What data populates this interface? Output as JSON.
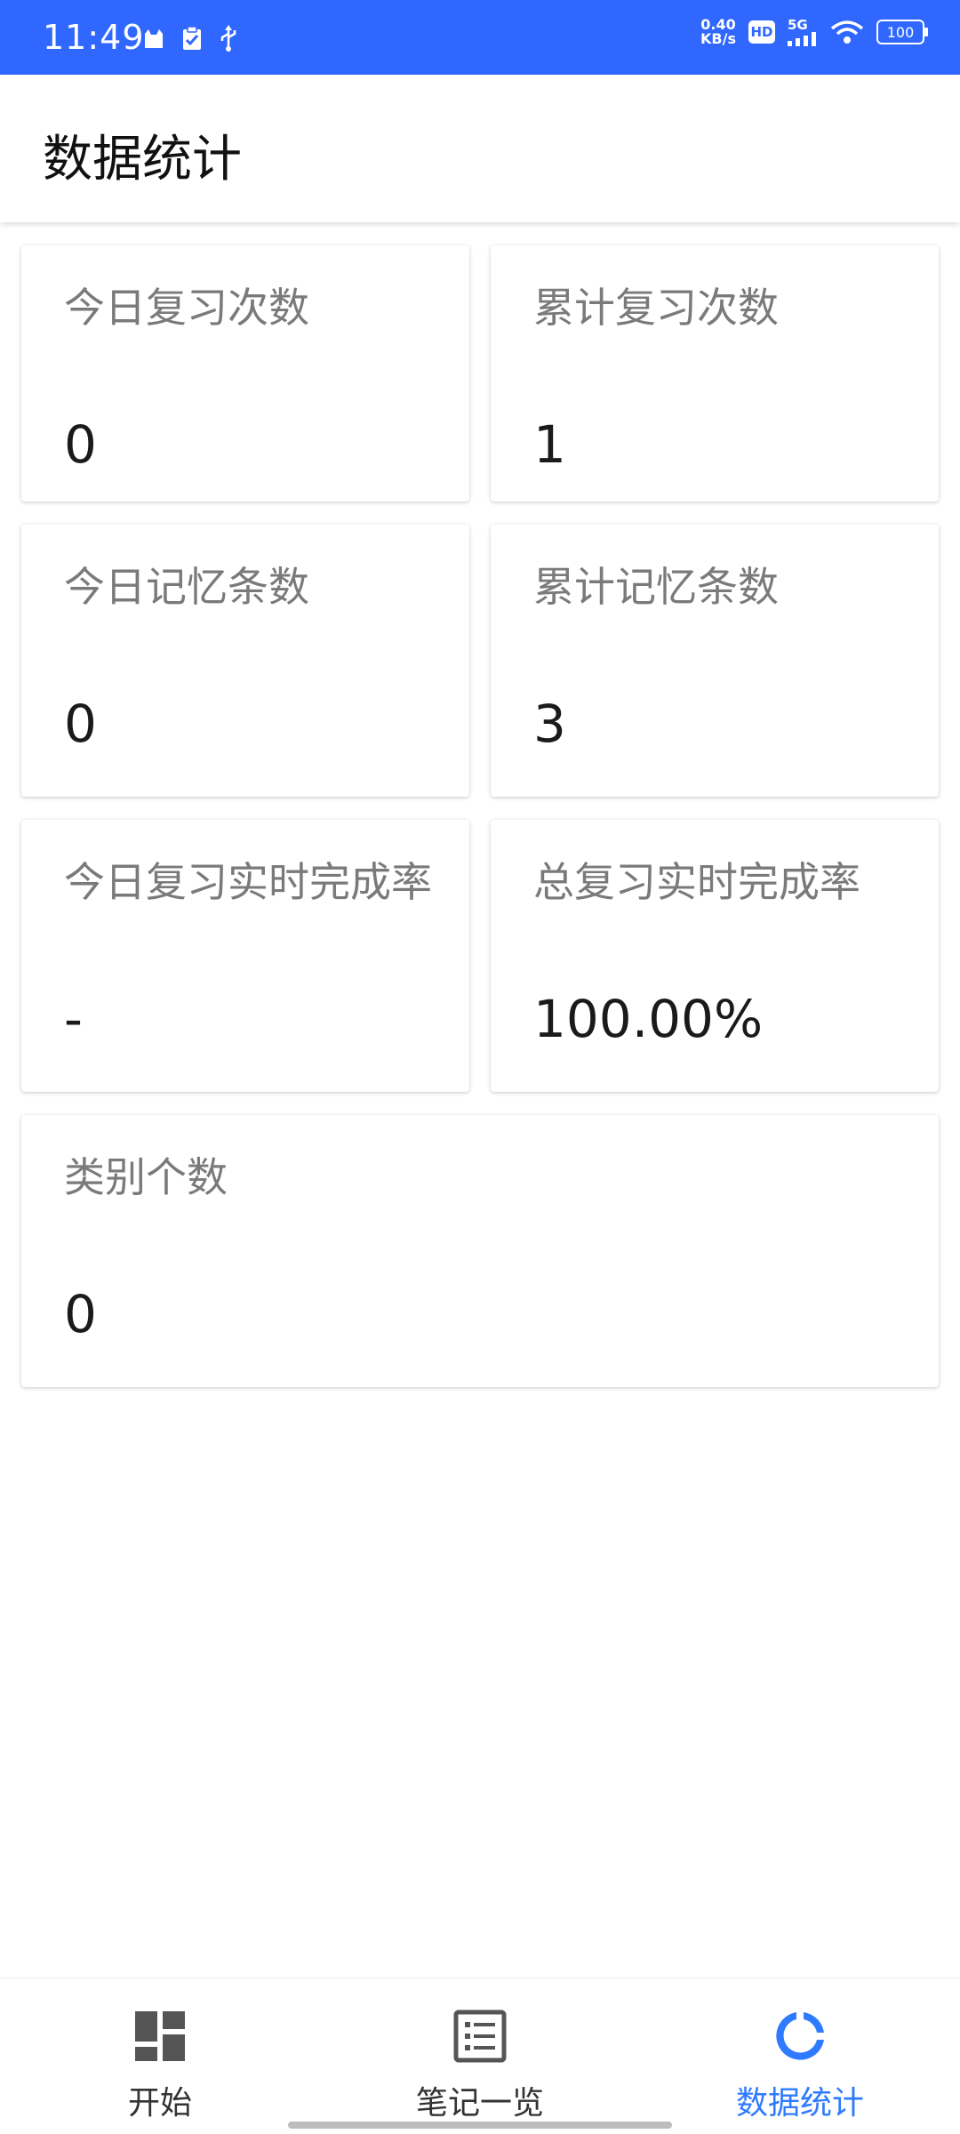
{
  "status_bar": {
    "time": "11:49",
    "net_speed_value": "0.40",
    "net_speed_unit": "KB/s",
    "hd_label": "HD",
    "network_label": "5G",
    "battery_level": "100",
    "color": "#2f67ff"
  },
  "header": {
    "title": "数据统计"
  },
  "stats": {
    "today_review_count": {
      "label": "今日复习次数",
      "value": "0"
    },
    "total_review_count": {
      "label": "累计复习次数",
      "value": "1"
    },
    "today_memory_items": {
      "label": "今日记忆条数",
      "value": "0"
    },
    "total_memory_items": {
      "label": "累计记忆条数",
      "value": "3"
    },
    "today_completion_rate": {
      "label": "今日复习实时完成率",
      "value": "-"
    },
    "total_completion_rate": {
      "label": "总复习实时完成率",
      "value": "100.00%"
    },
    "category_count": {
      "label": "类别个数",
      "value": "0"
    }
  },
  "bottom_nav": {
    "items": [
      {
        "label": "开始",
        "icon": "dashboard-icon"
      },
      {
        "label": "笔记一览",
        "icon": "list-icon"
      },
      {
        "label": "数据统计",
        "icon": "donut-chart-icon",
        "active": true
      }
    ],
    "active_color": "#2f7bff"
  }
}
